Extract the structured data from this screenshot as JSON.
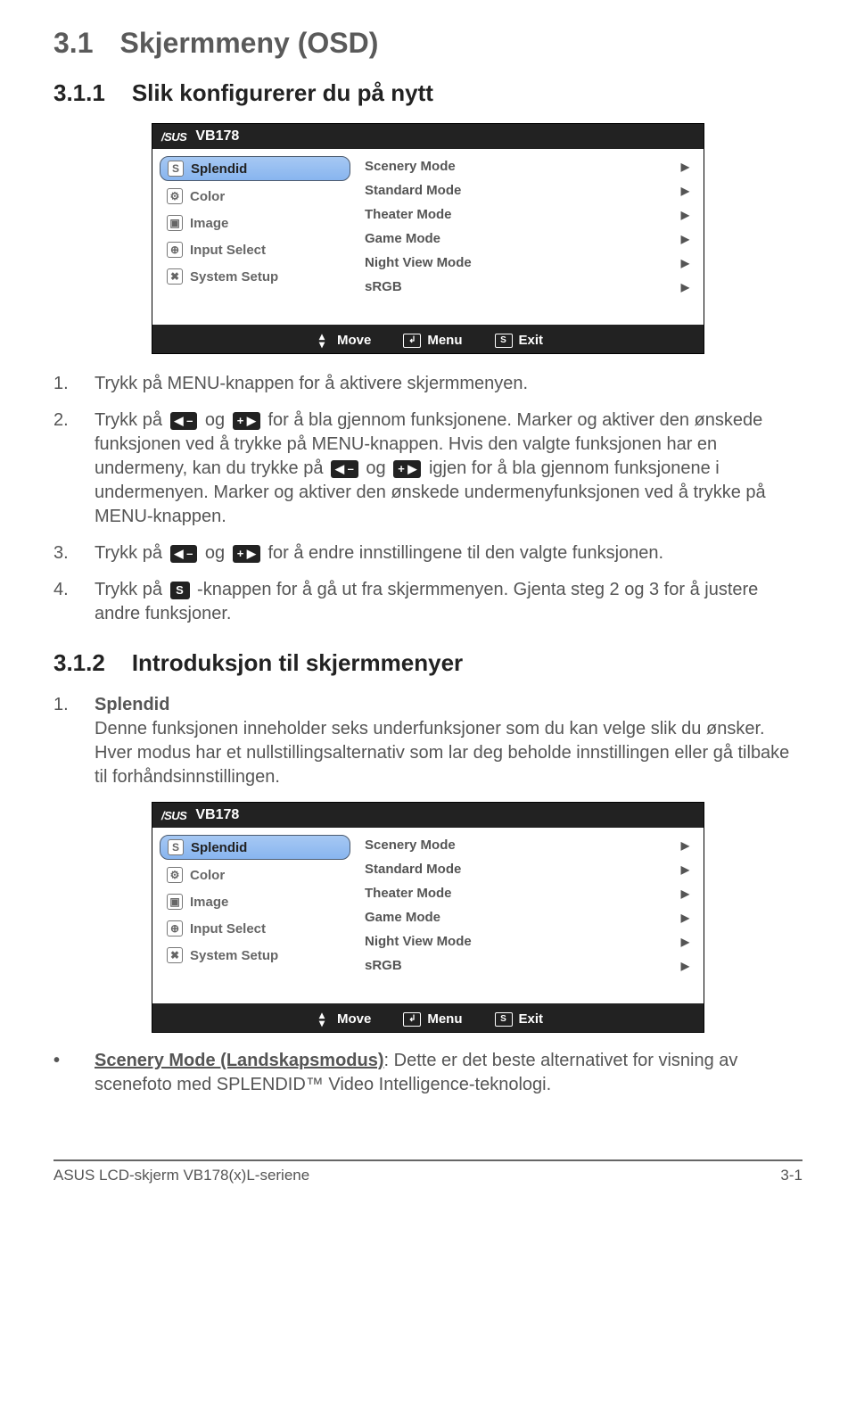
{
  "headings": {
    "h1_no": "3.1",
    "h1_title": "Skjermmeny (OSD)",
    "h2_no": "3.1.1",
    "h2_title": "Slik konfigurerer du på nytt",
    "h3_no": "3.1.2",
    "h3_title": "Introduksjon til skjermmenyer"
  },
  "osd": {
    "brand": "/SUS",
    "model": "VB178",
    "left": [
      {
        "icon": "S",
        "label": "Splendid",
        "selected": true
      },
      {
        "icon": "⚙",
        "label": "Color",
        "selected": false
      },
      {
        "icon": "▣",
        "label": "Image",
        "selected": false
      },
      {
        "icon": "⊕",
        "label": "Input Select",
        "selected": false
      },
      {
        "icon": "✖",
        "label": "System Setup",
        "selected": false
      }
    ],
    "right": [
      "Scenery Mode",
      "Standard Mode",
      "Theater Mode",
      "Game Mode",
      "Night View Mode",
      "sRGB"
    ],
    "foot": {
      "move": "Move",
      "menu": "Menu",
      "exit": "Exit"
    }
  },
  "steps": {
    "s1": {
      "n": "1.",
      "t": "Trykk på MENU-knappen for å aktivere skjermmenyen."
    },
    "s2": {
      "n": "2.",
      "pre": "Trykk på ",
      "mid": " og ",
      "post1": " for å bla gjennom funksjonene. Marker og aktiver den ønskede funksjonen ved å trykke på MENU-knappen. Hvis den valgte funksjonen har en undermeny, kan du trykke på ",
      "mid2": " og ",
      "post2": " igjen for å bla gjennom funksjonene i undermenyen. Marker og aktiver den ønskede undermenyfunksjonen ved å trykke på MENU-knappen."
    },
    "s3": {
      "n": "3.",
      "pre": "Trykk på ",
      "mid": " og ",
      "post": " for å endre innstillingene til den valgte funksjonen."
    },
    "s4": {
      "n": "4.",
      "pre": "Trykk på ",
      "post": " -knappen for å gå ut fra skjermmenyen. Gjenta steg 2 og 3 for å justere andre funksjoner."
    }
  },
  "icons_inline": {
    "left_minus": "◀ –",
    "plus_right": "+ ▶",
    "s_box": "S"
  },
  "item1": {
    "n": "1.",
    "title": "Splendid",
    "desc": "Denne funksjonen inneholder seks underfunksjoner som du kan velge slik du ønsker. Hver modus har et nullstillingsalternativ som lar deg beholde innstillingen eller gå tilbake til forhåndsinnstillingen."
  },
  "bullet": {
    "dot": "•",
    "bold": "Scenery Mode (Landskapsmodus)",
    "rest": ": Dette er det beste alternativet for visning av scenefoto med SPLENDID™ Video Intelligence-teknologi."
  },
  "footer": {
    "left": "ASUS LCD-skjerm VB178(x)L-seriene",
    "right": "3-1"
  }
}
